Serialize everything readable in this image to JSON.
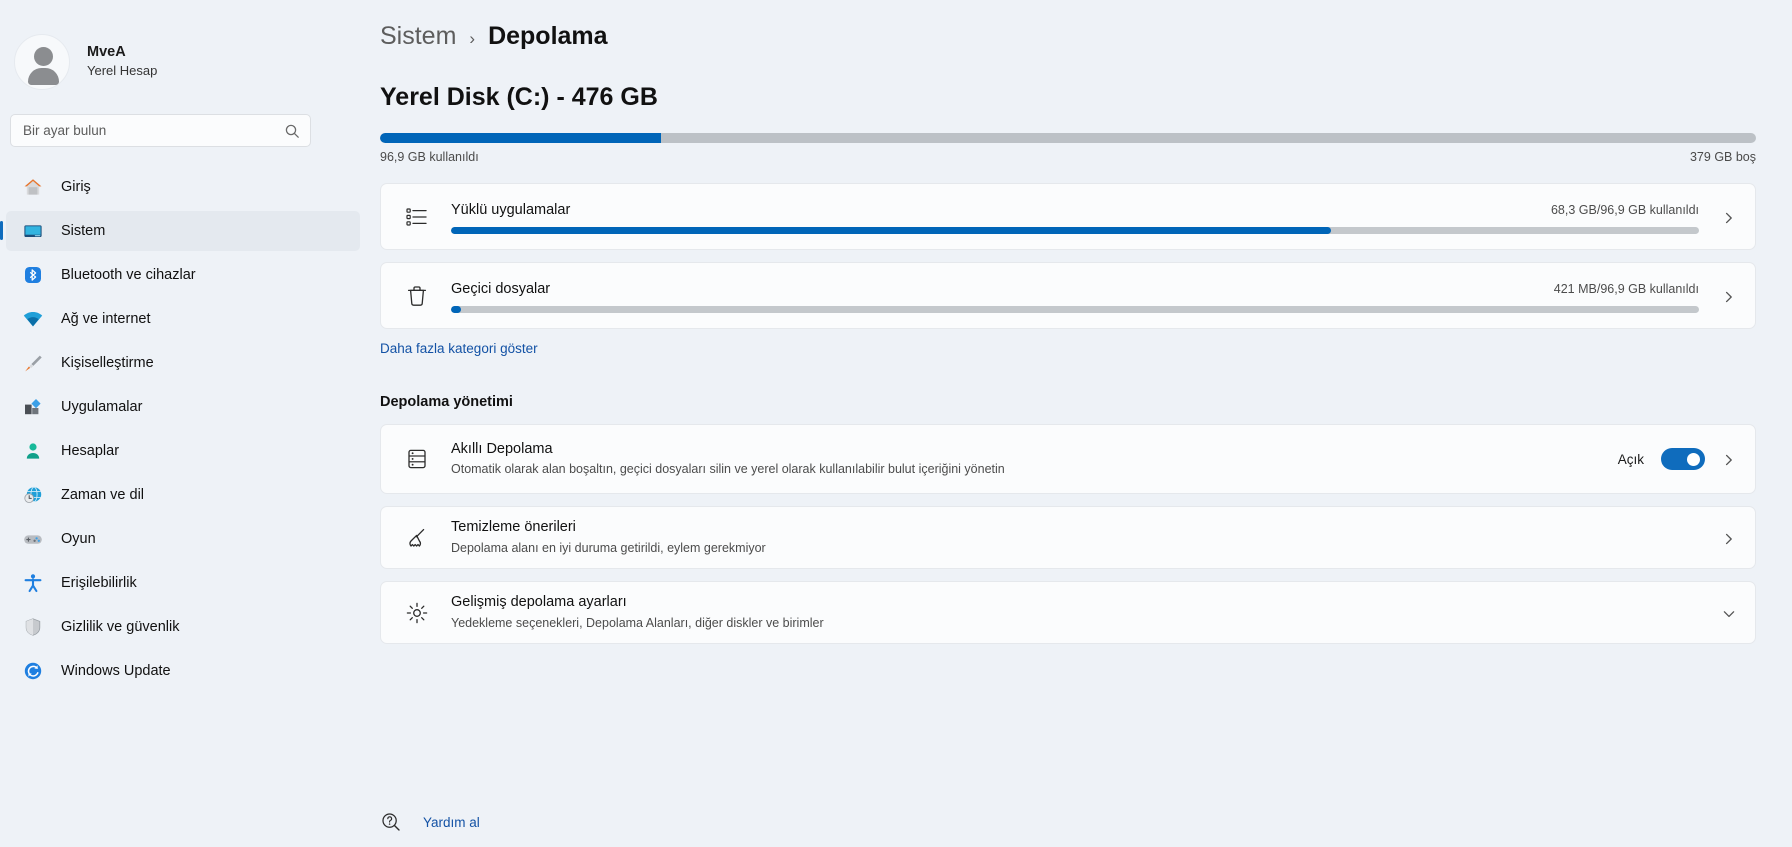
{
  "profile": {
    "name": "MveA",
    "account_type": "Yerel Hesap",
    "avatar_icon": "person-avatar-icon"
  },
  "search": {
    "placeholder": "Bir ayar bulun",
    "icon": "search-icon"
  },
  "sidebar": {
    "items": [
      {
        "label": "Giriş",
        "icon": "home-icon",
        "selected": false
      },
      {
        "label": "Sistem",
        "icon": "monitor-icon",
        "selected": true
      },
      {
        "label": "Bluetooth ve cihazlar",
        "icon": "bluetooth-icon",
        "selected": false
      },
      {
        "label": "Ağ ve internet",
        "icon": "wifi-icon",
        "selected": false
      },
      {
        "label": "Kişiselleştirme",
        "icon": "paintbrush-icon",
        "selected": false
      },
      {
        "label": "Uygulamalar",
        "icon": "apps-icon",
        "selected": false
      },
      {
        "label": "Hesaplar",
        "icon": "account-icon",
        "selected": false
      },
      {
        "label": "Zaman ve dil",
        "icon": "clock-globe-icon",
        "selected": false
      },
      {
        "label": "Oyun",
        "icon": "gamepad-icon",
        "selected": false
      },
      {
        "label": "Erişilebilirlik",
        "icon": "accessibility-icon",
        "selected": false
      },
      {
        "label": "Gizlilik ve güvenlik",
        "icon": "shield-icon",
        "selected": false
      },
      {
        "label": "Windows Update",
        "icon": "update-icon",
        "selected": false
      }
    ]
  },
  "breadcrumb": {
    "parent": "Sistem",
    "separator": "›",
    "current": "Depolama"
  },
  "disk": {
    "title": "Yerel Disk (C:) - 476 GB",
    "used_label": "96,9 GB kullanıldı",
    "free_label": "379 GB boş",
    "used_percent": 20.4
  },
  "categories": [
    {
      "name": "Yüklü uygulamalar",
      "usage": "68,3 GB/96,9 GB kullanıldı",
      "percent": 70.5,
      "icon": "app-list-icon",
      "chevron": "chevron-right-icon"
    },
    {
      "name": "Geçici dosyalar",
      "usage": "421 MB/96,9 GB kullanıldı",
      "percent": 0.8,
      "icon": "trash-icon",
      "chevron": "chevron-right-icon"
    }
  ],
  "show_more_link": "Daha fazla kategori göster",
  "management": {
    "section_title": "Depolama yönetimi",
    "rows": [
      {
        "title": "Akıllı Depolama",
        "subtitle": "Otomatik olarak alan boşaltın, geçici dosyaları silin ve yerel olarak kullanılabilir bulut içeriğini yönetin",
        "icon": "storage-sense-icon",
        "toggle_state": "Açık",
        "toggle_on": true,
        "chevron": "chevron-right-icon"
      },
      {
        "title": "Temizleme önerileri",
        "subtitle": "Depolama alanı en iyi duruma getirildi, eylem gerekmiyor",
        "icon": "broom-icon",
        "chevron": "chevron-right-icon"
      },
      {
        "title": "Gelişmiş depolama ayarları",
        "subtitle": "Yedekleme seçenekleri, Depolama Alanları, diğer diskler ve birimler",
        "icon": "gear-icon",
        "chevron": "chevron-down-icon"
      }
    ]
  },
  "help": {
    "label": "Yardım al",
    "icon": "help-question-icon"
  },
  "colors": {
    "accent": "#0f6cbd",
    "bar_fill": "#0065b8",
    "bar_track": "#bcc1c6",
    "link": "#1352a5",
    "background": "#eef2f7",
    "card": "#fbfcfd"
  }
}
